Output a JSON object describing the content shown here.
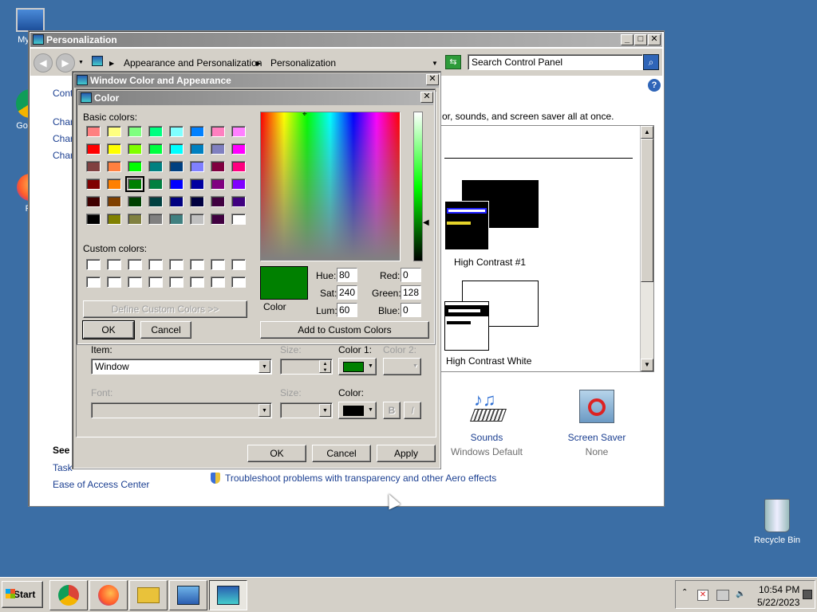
{
  "desktop": {
    "icons": [
      {
        "label": "My Co",
        "icon": "computer-icon"
      },
      {
        "label": "Google",
        "icon": "chrome-icon"
      },
      {
        "label": "Fir",
        "icon": "firefox-icon"
      },
      {
        "label": "Recycle Bin",
        "icon": "recycle-bin-icon"
      }
    ]
  },
  "personalization": {
    "title": "Personalization",
    "breadcrumb": [
      "Appearance and Personalization",
      "Personalization"
    ],
    "search_placeholder": "Search Control Panel",
    "left_links": [
      "Cont",
      "Char",
      "Char",
      "Char"
    ],
    "see_also": "See",
    "see_also_links": [
      "Task",
      "Ease of Access Center"
    ],
    "intro_text": "or, sounds, and screen saver all at once.",
    "themes": [
      {
        "label": "High Contrast #1"
      },
      {
        "label": "High Contrast White"
      }
    ],
    "sounds": {
      "label": "Sounds",
      "sub": "Windows Default"
    },
    "screensaver": {
      "label": "Screen Saver",
      "sub": "None"
    },
    "troubleshoot_link": "Troubleshoot problems with transparency and other Aero effects"
  },
  "wca": {
    "title": "Window Color and Appearance",
    "item_label": "Item:",
    "item_value": "Window",
    "size_label": "Size:",
    "color1_label": "Color 1:",
    "color2_label": "Color 2:",
    "font_label": "Font:",
    "font_size_label": "Size:",
    "font_color_label": "Color:",
    "bold_label": "B",
    "italic_label": "I",
    "ok": "OK",
    "cancel": "Cancel",
    "apply": "Apply",
    "color1_value": "#008000",
    "font_color_value": "#000000"
  },
  "color_dialog": {
    "title": "Color",
    "basic_label": "Basic colors:",
    "custom_label": "Custom colors:",
    "define_btn": "Define Custom Colors >>",
    "ok": "OK",
    "cancel": "Cancel",
    "add_btn": "Add to Custom Colors",
    "color_label": "Color",
    "hue_label": "Hue:",
    "hue": "80",
    "sat_label": "Sat:",
    "sat": "240",
    "lum_label": "Lum:",
    "lum": "60",
    "red_label": "Red:",
    "red": "0",
    "green_label": "Green:",
    "green": "128",
    "blue_label": "Blue:",
    "blue": "0",
    "current_color": "#008000",
    "basic_colors": [
      "#ff8080",
      "#ffff80",
      "#80ff80",
      "#00ff80",
      "#80ffff",
      "#0080ff",
      "#ff80c0",
      "#ff80ff",
      "#ff0000",
      "#ffff00",
      "#80ff00",
      "#00ff40",
      "#00ffff",
      "#0080c0",
      "#8080c0",
      "#ff00ff",
      "#804040",
      "#ff8040",
      "#00ff00",
      "#008080",
      "#004080",
      "#8080ff",
      "#800040",
      "#ff0080",
      "#800000",
      "#ff8000",
      "#008000",
      "#008040",
      "#0000ff",
      "#0000a0",
      "#800080",
      "#8000ff",
      "#400000",
      "#804000",
      "#004000",
      "#004040",
      "#000080",
      "#000040",
      "#400040",
      "#400080",
      "#000000",
      "#808000",
      "#808040",
      "#808080",
      "#408080",
      "#c0c0c0",
      "#400040",
      "#ffffff"
    ],
    "selected_index": 26
  },
  "taskbar": {
    "start": "Start",
    "time": "10:54 PM",
    "date": "5/22/2023"
  }
}
